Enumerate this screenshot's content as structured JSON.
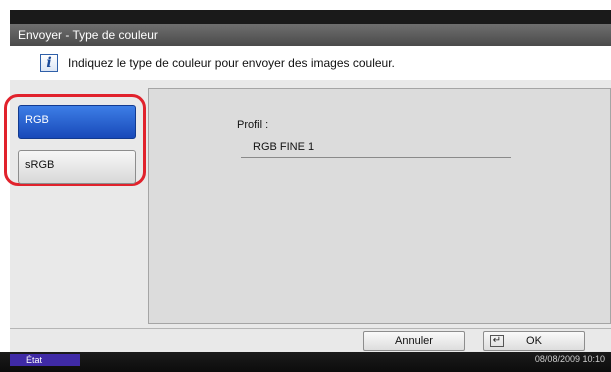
{
  "window": {
    "title": "Envoyer - Type de couleur"
  },
  "info": {
    "text": "Indiquez le type de couleur pour envoyer des images couleur."
  },
  "options": [
    {
      "label": "RGB",
      "selected": true
    },
    {
      "label": "sRGB",
      "selected": false
    }
  ],
  "profile": {
    "label": "Profil :",
    "value": "RGB FINE 1"
  },
  "footer": {
    "cancel_label": "Annuler",
    "ok_label": "OK"
  },
  "status": {
    "state": "État",
    "datetime": "08/08/2009   10:10"
  },
  "colors": {
    "accent": "#1f5fd2",
    "highlight_ring": "#e1222c",
    "status_chip": "#3f2aa6"
  },
  "icons": {
    "info": "info-icon",
    "enter": "enter-icon"
  }
}
